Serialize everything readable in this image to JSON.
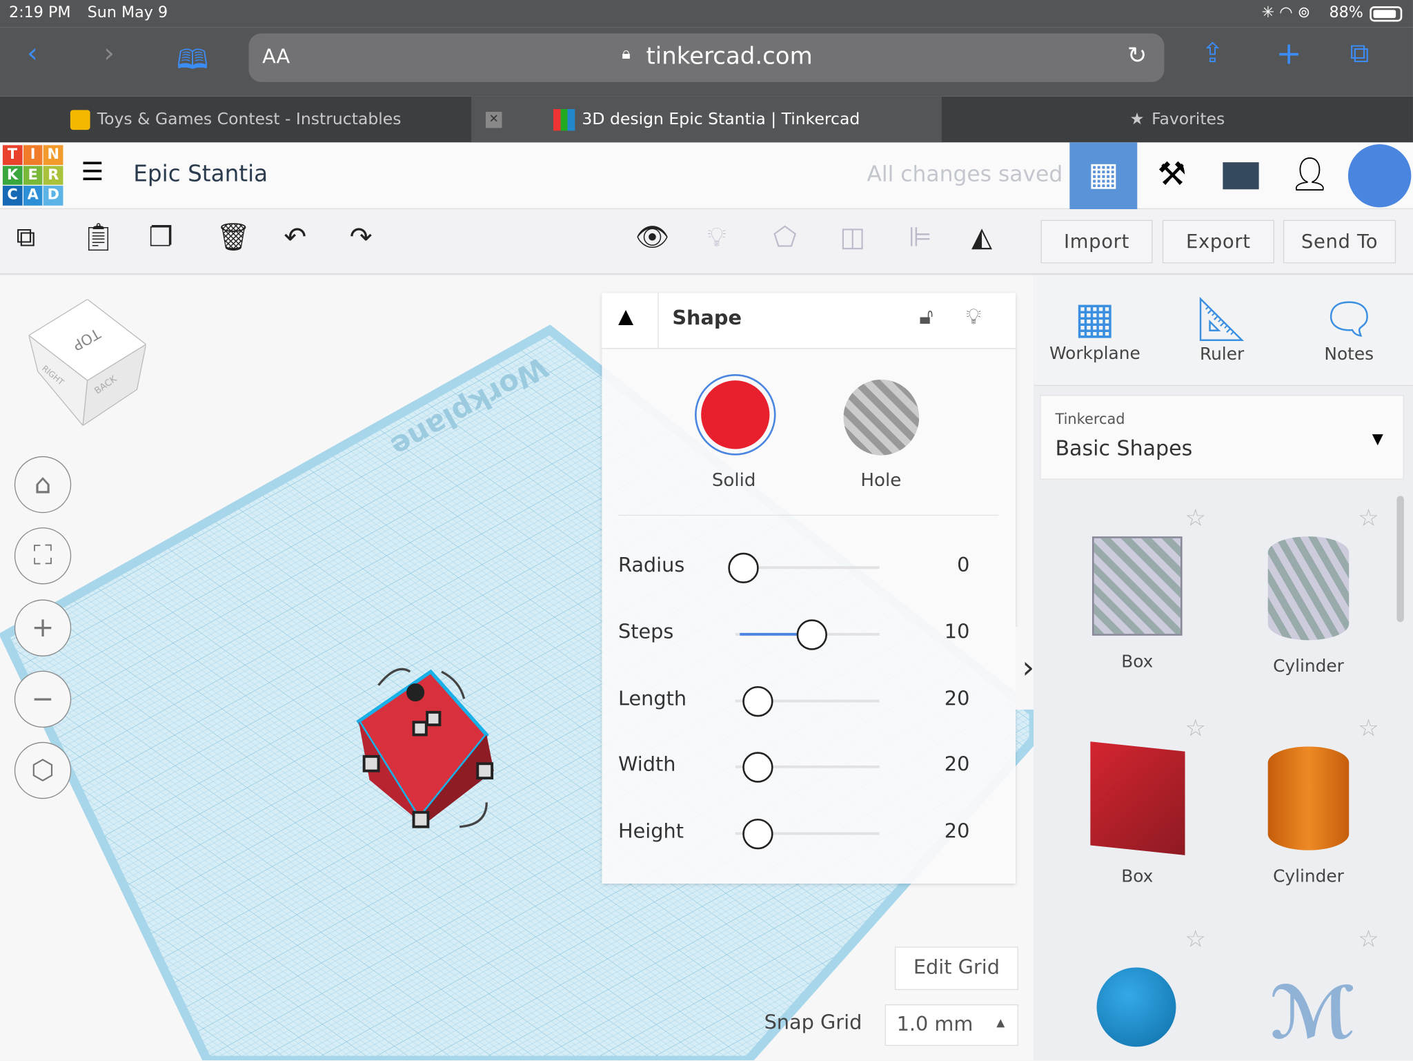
{
  "status_bar": {
    "time": "2:19 PM",
    "date": "Sun May 9",
    "battery": "88%"
  },
  "browser": {
    "text_size": "AA",
    "url": "tinkercad.com",
    "icons": [
      "back-icon",
      "forward-icon",
      "bookmarks-icon",
      "lock-icon",
      "reload-icon",
      "share-icon",
      "new-tab-icon",
      "tabs-icon"
    ]
  },
  "tabs": [
    {
      "label": "Toys & Games Contest - Instructables"
    },
    {
      "label": "3D design Epic Stantia | Tinkercad",
      "active": true
    },
    {
      "label": "Favorites"
    }
  ],
  "app": {
    "logo": [
      "T",
      "I",
      "N",
      "K",
      "E",
      "R",
      "C",
      "A",
      "D"
    ],
    "title": "Epic Stantia",
    "save_status": "All changes saved",
    "accent": "#5b93d9"
  },
  "toolbar": {
    "import": "Import",
    "export": "Export",
    "send_to": "Send To"
  },
  "viewcube": {
    "top": "TOP",
    "right": "RIGHT",
    "back": "BACK"
  },
  "workplane_label": "Workplane",
  "shape_panel": {
    "title": "Shape",
    "solid": "Solid",
    "hole": "Hole",
    "solid_color": "#e8202e",
    "params": [
      {
        "label": "Radius",
        "value": "0",
        "fraction": 0
      },
      {
        "label": "Steps",
        "value": "10",
        "fraction": 0.5
      },
      {
        "label": "Length",
        "value": "20",
        "fraction": 0.1
      },
      {
        "label": "Width",
        "value": "20",
        "fraction": 0.1
      },
      {
        "label": "Height",
        "value": "20",
        "fraction": 0.1
      }
    ]
  },
  "grid": {
    "edit_grid": "Edit Grid",
    "snap_label": "Snap Grid",
    "snap_value": "1.0 mm"
  },
  "right_panel": {
    "tools": [
      {
        "label": "Workplane"
      },
      {
        "label": "Ruler"
      },
      {
        "label": "Notes"
      }
    ],
    "library_source": "Tinkercad",
    "library_name": "Basic Shapes",
    "shapes": [
      {
        "label": "Box"
      },
      {
        "label": "Cylinder"
      },
      {
        "label": "Box"
      },
      {
        "label": "Cylinder"
      }
    ]
  }
}
